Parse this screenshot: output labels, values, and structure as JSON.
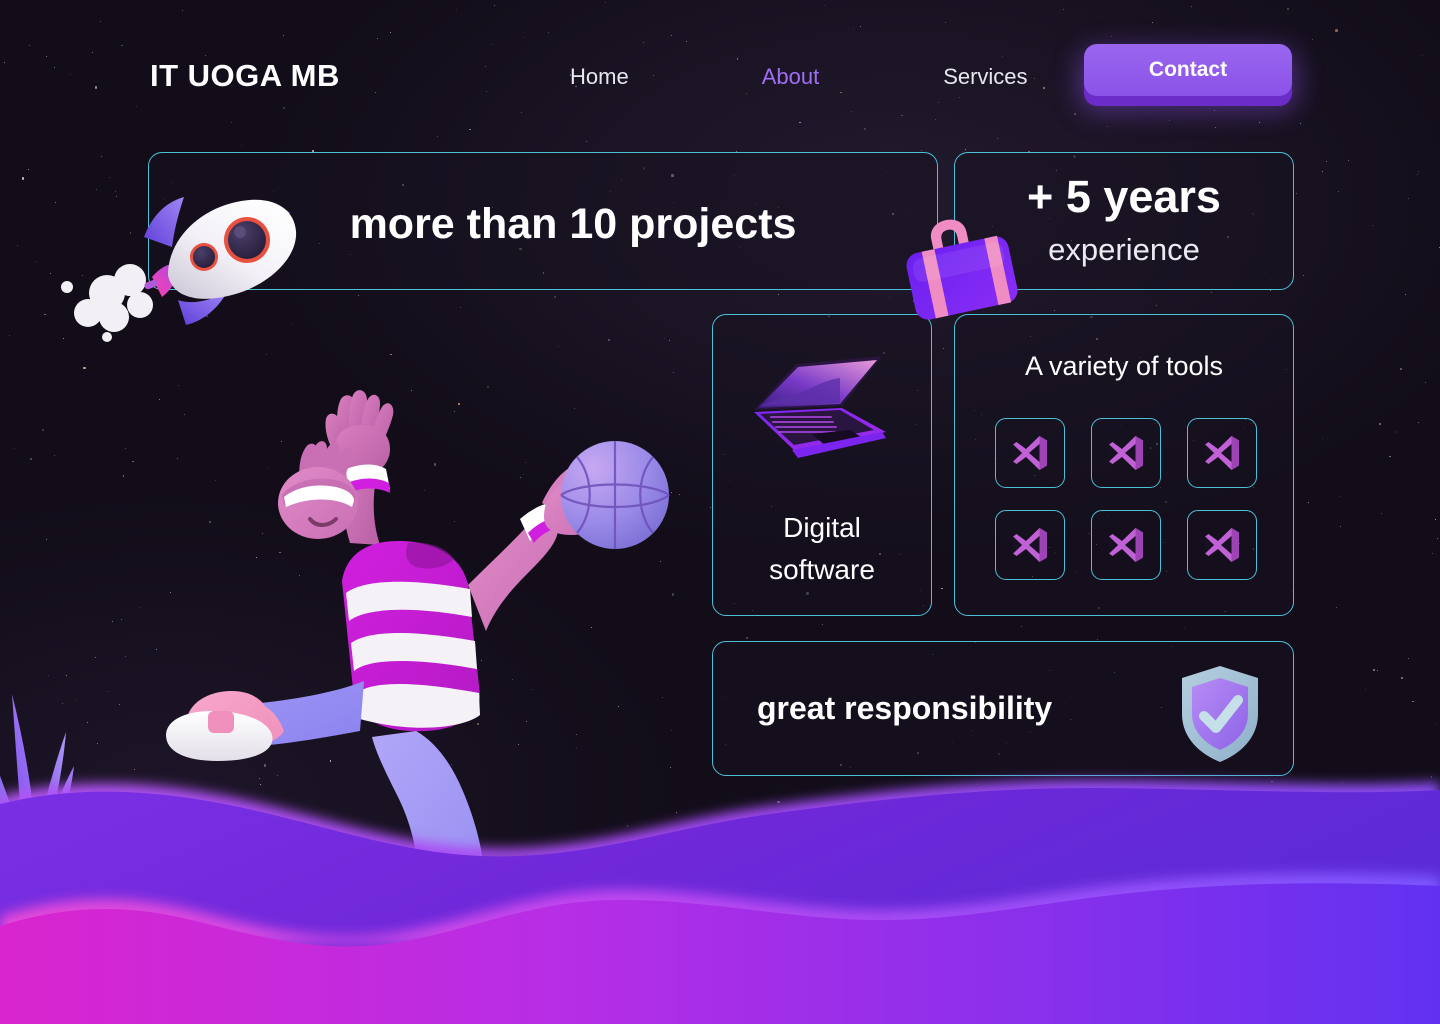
{
  "brand": {
    "logo": "IT UOGA MB"
  },
  "nav": {
    "items": [
      {
        "label": "Home",
        "active": false
      },
      {
        "label": "About",
        "active": true
      },
      {
        "label": "Services",
        "active": false
      }
    ],
    "cta": {
      "label": "Contact"
    }
  },
  "cards": {
    "projects": {
      "title": "more than 10 projects",
      "icon": "rocket-illustration"
    },
    "years": {
      "headline": "+ 5 years",
      "subline": "experience",
      "icon": "suitcase-illustration"
    },
    "digital": {
      "line1": "Digital",
      "line2": "software",
      "icon": "laptop-illustration"
    },
    "tools": {
      "title": "A variety of tools",
      "items": [
        {
          "icon": "visual-studio-icon"
        },
        {
          "icon": "visual-studio-icon"
        },
        {
          "icon": "visual-studio-icon"
        },
        {
          "icon": "visual-studio-icon"
        },
        {
          "icon": "visual-studio-icon"
        },
        {
          "icon": "visual-studio-icon"
        }
      ]
    },
    "responsibility": {
      "title": "great responsibility",
      "icon": "shield-check-illustration"
    }
  },
  "decor": {
    "character": "basketball-player-illustration",
    "plant": "plant-illustration",
    "waves": "wave-background"
  },
  "colors": {
    "background": "#120d19",
    "card_border": "#4cc0d6",
    "nav_active": "#a06ef5",
    "cta_fill": "#9a66ef",
    "cta_shadow": "#6b2cc9",
    "tool_icon": "#c061d6",
    "wave_upper": "#7b2fe8",
    "wave_lower": "#d928c9",
    "text_primary": "#ffffff"
  }
}
